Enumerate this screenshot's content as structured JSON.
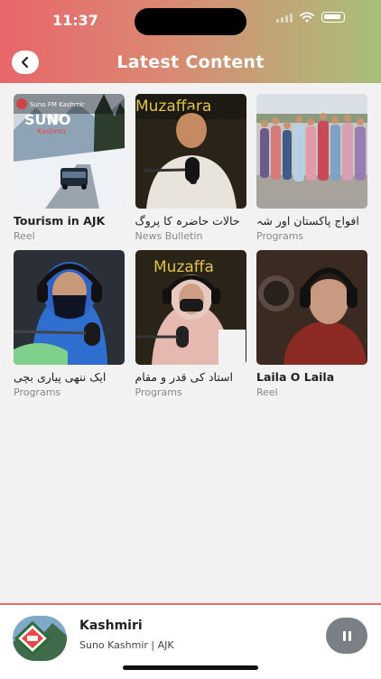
{
  "status_bar": {
    "time": "11:37"
  },
  "header": {
    "title": "Latest Content"
  },
  "grid": {
    "items": [
      {
        "title": "Tourism in AJK",
        "category": "Reel",
        "rtl": false,
        "thumb_icon": "snow-road-thumbnail",
        "overlay_top": "Suno FM Kashmir",
        "overlay_logo": "SUNO",
        "overlay_logo_sub": "Kashmir"
      },
      {
        "title": "حالات حاضرہ کا پروگ",
        "category": "News Bulletin",
        "rtl": true,
        "thumb_icon": "man-at-microphone-thumbnail",
        "overlay_logo": "Muzaffara"
      },
      {
        "title": "افواج پاکستان اور شہ",
        "category": "Programs",
        "rtl": true,
        "thumb_icon": "crowd-outdoors-thumbnail"
      },
      {
        "title": "ایک ننھی پیاری بچی",
        "category": "Programs",
        "rtl": true,
        "thumb_icon": "woman-headphones-thumbnail"
      },
      {
        "title": "استاد کی قدر و مقام",
        "category": "Programs",
        "rtl": true,
        "thumb_icon": "woman-at-microphone-thumbnail",
        "overlay_logo": "Muzaffa"
      },
      {
        "title": "Laila O Laila",
        "category": "Reel",
        "rtl": false,
        "thumb_icon": "singer-headphones-thumbnail"
      }
    ]
  },
  "player": {
    "title": "Kashmiri",
    "subtitle": "Suno Kashmir | AJK",
    "art_icon": "suno-kashmir-logo-art",
    "state_icon": "pause-icon"
  },
  "colors": {
    "header_start": "#e8666a",
    "header_end": "#a8bf7a",
    "accent": "#e56a6a"
  }
}
